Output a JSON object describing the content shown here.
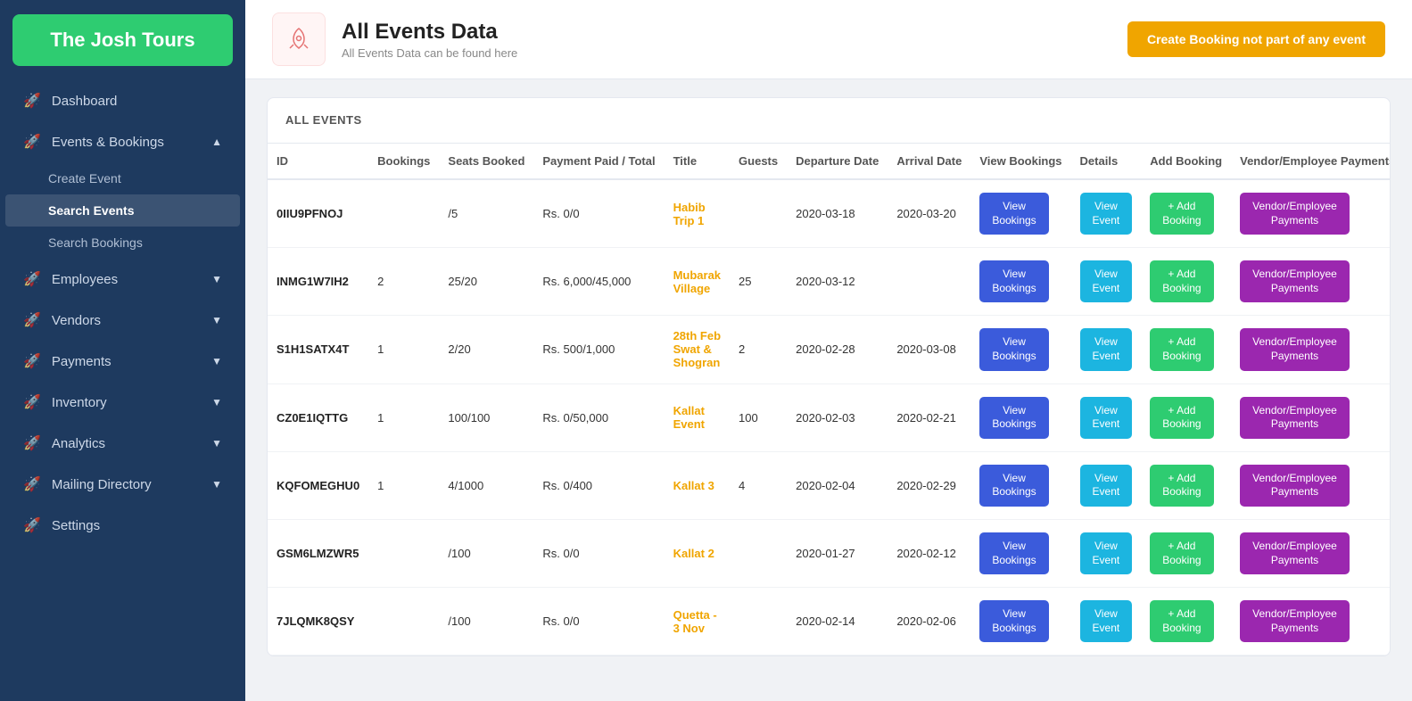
{
  "app": {
    "title": "The Josh Tours"
  },
  "sidebar": {
    "logo": "The Josh Tours",
    "nav": [
      {
        "id": "dashboard",
        "label": "Dashboard",
        "icon": "🚀",
        "hasArrow": false
      },
      {
        "id": "events-bookings",
        "label": "Events & Bookings",
        "icon": "🚀",
        "hasArrow": true,
        "expanded": true,
        "children": [
          {
            "id": "create-event",
            "label": "Create Event"
          },
          {
            "id": "search-events",
            "label": "Search Events",
            "active": true
          },
          {
            "id": "search-bookings",
            "label": "Search Bookings"
          }
        ]
      },
      {
        "id": "employees",
        "label": "Employees",
        "icon": "🚀",
        "hasArrow": true
      },
      {
        "id": "vendors",
        "label": "Vendors",
        "icon": "🚀",
        "hasArrow": true
      },
      {
        "id": "payments",
        "label": "Payments",
        "icon": "🚀",
        "hasArrow": true
      },
      {
        "id": "inventory",
        "label": "Inventory",
        "icon": "🚀",
        "hasArrow": true
      },
      {
        "id": "analytics",
        "label": "Analytics",
        "icon": "🚀",
        "hasArrow": true
      },
      {
        "id": "mailing-directory",
        "label": "Mailing Directory",
        "icon": "🚀",
        "hasArrow": true
      },
      {
        "id": "settings",
        "label": "Settings",
        "icon": "🚀",
        "hasArrow": false
      }
    ]
  },
  "header": {
    "title": "All Events Data",
    "subtitle": "All Events Data can be found here",
    "create_btn_label": "Create Booking not part of any event"
  },
  "table": {
    "section_title": "ALL EVENTS",
    "columns": [
      "ID",
      "Bookings",
      "Seats Booked",
      "Payment Paid / Total",
      "Title",
      "Guests",
      "Departure Date",
      "Arrival Date",
      "View Bookings",
      "Details",
      "Add Booking",
      "Vendor/Employee Payments"
    ],
    "rows": [
      {
        "id": "0IIU9PFNOJ",
        "bookings": "",
        "seats_booked": "/5",
        "payment": "Rs. 0/0",
        "title": "Habib Trip 1",
        "guests": "",
        "departure": "2020-03-18",
        "arrival": "2020-03-20",
        "btn_view_bookings": "View Bookings",
        "btn_view_event": "View Event",
        "btn_add_booking": "+ Add Booking",
        "btn_vendor": "Vendor/Employee Payments"
      },
      {
        "id": "INMG1W7IH2",
        "bookings": "2",
        "seats_booked": "25/20",
        "payment": "Rs. 6,000/45,000",
        "title": "Mubarak Village",
        "guests": "25",
        "departure": "2020-03-12",
        "arrival": "",
        "btn_view_bookings": "View Bookings",
        "btn_view_event": "View Event",
        "btn_add_booking": "+ Add Booking",
        "btn_vendor": "Vendor/Employee Payments"
      },
      {
        "id": "S1H1SATX4T",
        "bookings": "1",
        "seats_booked": "2/20",
        "payment": "Rs. 500/1,000",
        "title": "28th Feb Swat & Shogran",
        "guests": "2",
        "departure": "2020-02-28",
        "arrival": "2020-03-08",
        "btn_view_bookings": "View Bookings",
        "btn_view_event": "View Event",
        "btn_add_booking": "+ Add Booking",
        "btn_vendor": "Vendor/Employee Payments"
      },
      {
        "id": "CZ0E1IQTTG",
        "bookings": "1",
        "seats_booked": "100/100",
        "payment": "Rs. 0/50,000",
        "title": "Kallat Event",
        "guests": "100",
        "departure": "2020-02-03",
        "arrival": "2020-02-21",
        "btn_view_bookings": "View Bookings",
        "btn_view_event": "View Event",
        "btn_add_booking": "+ Add Booking",
        "btn_vendor": "Vendor/Employee Payments"
      },
      {
        "id": "KQFOMEGHU0",
        "bookings": "1",
        "seats_booked": "4/1000",
        "payment": "Rs. 0/400",
        "title": "Kallat 3",
        "guests": "4",
        "departure": "2020-02-04",
        "arrival": "2020-02-29",
        "btn_view_bookings": "View Bookings",
        "btn_view_event": "View Event",
        "btn_add_booking": "+ Add Booking",
        "btn_vendor": "Vendor/Employee Payments"
      },
      {
        "id": "GSM6LMZWR5",
        "bookings": "",
        "seats_booked": "/100",
        "payment": "Rs. 0/0",
        "title": "Kallat 2",
        "guests": "",
        "departure": "2020-01-27",
        "arrival": "2020-02-12",
        "btn_view_bookings": "View Bookings",
        "btn_view_event": "View Event",
        "btn_add_booking": "+ Add Booking",
        "btn_vendor": "Vendor/Employee Payments"
      },
      {
        "id": "7JLQMK8QSY",
        "bookings": "",
        "seats_booked": "/100",
        "payment": "Rs. 0/0",
        "title": "Quetta - 3 Nov",
        "guests": "",
        "departure": "2020-02-14",
        "arrival": "2020-02-06",
        "btn_view_bookings": "View Bookings",
        "btn_view_event": "View Event",
        "btn_add_booking": "+ Add Booking",
        "btn_vendor": "Vendor/Employee Payments"
      }
    ]
  }
}
